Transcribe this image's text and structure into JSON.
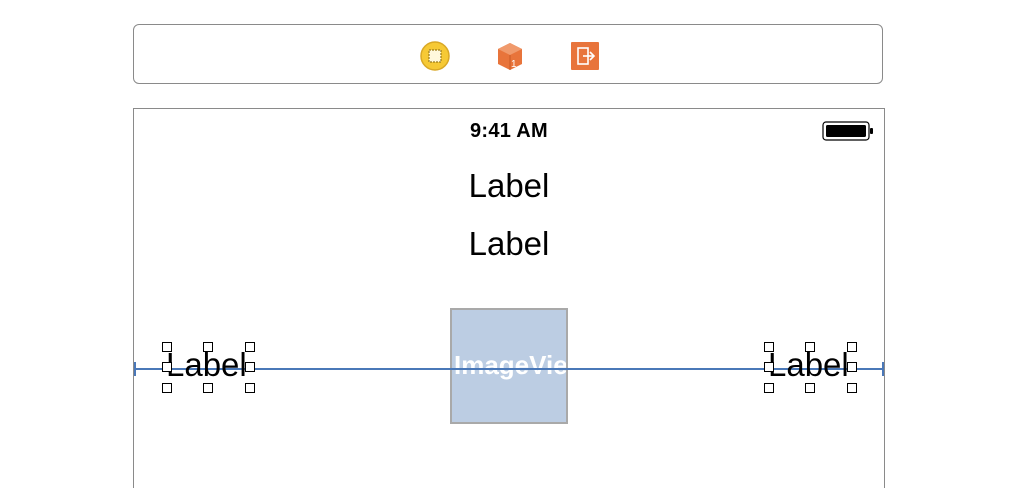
{
  "dock": {
    "icons": [
      {
        "name": "view-controller-icon",
        "color": "#f4c430"
      },
      {
        "name": "first-responder-icon",
        "color": "#e8743b"
      },
      {
        "name": "exit-icon",
        "color": "#e8743b"
      }
    ]
  },
  "device": {
    "status_bar": {
      "time": "9:41 AM"
    }
  },
  "view": {
    "label_top": "Label",
    "label_second": "Label",
    "image_view_text": "ImageView",
    "label_left": "Label",
    "label_right": "Label"
  },
  "colors": {
    "guide": "#4a78b8",
    "image_view_fill": "#bccde3"
  }
}
